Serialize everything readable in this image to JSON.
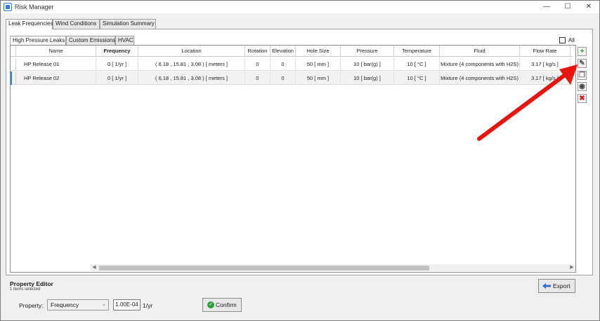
{
  "window": {
    "title": "Risk Manager",
    "minimize_glyph": "—",
    "maximize_glyph": "☐",
    "close_glyph": "✕"
  },
  "top_tabs": [
    {
      "label": "Leak Frequencies",
      "active": true
    },
    {
      "label": "Wind Conditions",
      "active": false
    },
    {
      "label": "Simulation Summary",
      "active": false
    }
  ],
  "sub_tabs": [
    {
      "label": "High Pressure Leaks",
      "active": true
    },
    {
      "label": "Custom Emissions",
      "active": false
    },
    {
      "label": "HVAC",
      "active": false
    }
  ],
  "all_checkbox": {
    "label": "All",
    "checked": false
  },
  "table": {
    "columns": [
      "Name",
      "Frequency",
      "Location",
      "Rotation",
      "Elevation",
      "Hole Size",
      "Pressure",
      "Temperature",
      "Fluid",
      "Flow Rate"
    ],
    "rows": [
      [
        "HP Release 01",
        "0 [ 1/yr ]",
        "( 6.18 , 15.81 , 3.08 ) [ meters ]",
        "0",
        "0",
        "50 [ mm ]",
        "10 [ bar(g) ]",
        "10 [ °C ]",
        "Mixture (4 components with H2S)",
        "3.17 [ kg/s ]"
      ],
      [
        "HP Release 02",
        "0 [ 1/yr ]",
        "( 6.18 , 15.81 , 3.08 ) [ meters ]",
        "0",
        "0",
        "50 [ mm ]",
        "10 [ bar(g) ]",
        "10 [ °C ]",
        "Mixture (4 components with H2S)",
        "3.17 [ kg/s ]"
      ]
    ]
  },
  "side_buttons": [
    {
      "name": "add-icon",
      "glyph": "+",
      "color": "#22a02c"
    },
    {
      "name": "edit-icon",
      "glyph": "✎",
      "color": "#555555"
    },
    {
      "name": "copy-icon",
      "glyph": "❐",
      "color": "#777777"
    },
    {
      "name": "eye-icon",
      "glyph": "◉",
      "color": "#444444"
    },
    {
      "name": "delete-icon",
      "glyph": "✖",
      "color": "#d0201c"
    }
  ],
  "property_editor": {
    "title": "Property Editor",
    "selection_info": "1 items selected",
    "property_label": "Property:",
    "property_selected": "Frequency",
    "value": "1.00E-04",
    "unit": "1/yr",
    "confirm_label": "Confirm",
    "export_label": "Export"
  },
  "colors": {
    "annotation_arrow": "#e8140e",
    "selection_marker": "#2a8ad8"
  }
}
